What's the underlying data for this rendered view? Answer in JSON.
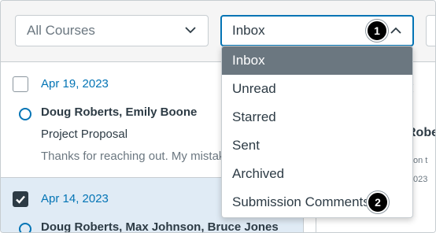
{
  "toolbar": {
    "course_filter": {
      "selected": "All Courses",
      "icon": "chevron-down-icon"
    },
    "mailbox_filter": {
      "selected": "Inbox",
      "icon": "chevron-up-icon"
    }
  },
  "mailbox_menu": {
    "options": [
      "Inbox",
      "Unread",
      "Starred",
      "Sent",
      "Archived",
      "Submission Comments"
    ],
    "highlighted": "Inbox"
  },
  "conversations": [
    {
      "date": "Apr 19, 2023",
      "participants": "Doug Roberts, Emily Boone",
      "subject": "Project Proposal",
      "preview": "Thanks for reaching out. My mistake l",
      "checked": false,
      "unread": true
    },
    {
      "date": "Apr 14, 2023",
      "participants": "Doug Roberts, Max Johnson, Bruce Jones",
      "checked": true,
      "unread": true
    }
  ],
  "preview_pane": {
    "name_fragment": "Robe",
    "line_fragment": "on t",
    "date_fragment": "023",
    "icon": "x-icon"
  },
  "callouts": [
    "1",
    "2"
  ],
  "colors": {
    "link": "#0374b5",
    "menu_highlight": "#6b7780",
    "selected_row": "#e0ebf5",
    "callout": "#000000"
  }
}
